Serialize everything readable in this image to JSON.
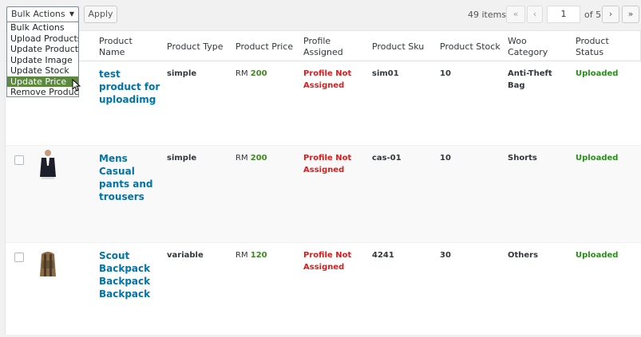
{
  "toolbar": {
    "bulk_select_value": "Bulk Actions",
    "apply_label": "Apply",
    "items_count": "49 items",
    "first_label": "«",
    "prev_label": "‹",
    "page_value": "1",
    "of_pages": "of 5",
    "next_label": "›",
    "last_label": "»"
  },
  "dropdown": {
    "options": [
      "Bulk Actions",
      "Upload Products",
      "Update Products",
      "Update Image",
      "Update Stock",
      "Update Price",
      "Remove Product"
    ],
    "selected": "Update Price"
  },
  "columns": {
    "name": "Product Name",
    "type": "Product Type",
    "price": "Product Price",
    "profile": "Profile Assigned",
    "sku": "Product Sku",
    "stock": "Product Stock",
    "category": "Woo Category",
    "status": "Product Status"
  },
  "rows": [
    {
      "name": "test product for uploadimg",
      "type": "simple",
      "currency": "RM",
      "price": "200",
      "profile": "Profile Not Assigned",
      "sku": "sim01",
      "stock": "10",
      "category": "Anti-Theft Bag",
      "status": "Uploaded"
    },
    {
      "name": "Mens Casual pants and trousers",
      "type": "simple",
      "currency": "RM",
      "price": "200",
      "profile": "Profile Not Assigned",
      "sku": "cas-01",
      "stock": "10",
      "category": "Shorts",
      "status": "Uploaded"
    },
    {
      "name": "Scout Backpack Backpack Backpack",
      "type": "variable",
      "currency": "RM",
      "price": "120",
      "profile": "Profile Not Assigned",
      "sku": "4241",
      "stock": "30",
      "category": "Others",
      "status": "Uploaded"
    }
  ],
  "colors": {
    "link": "#0073aa",
    "price": "#3c8a1f",
    "not_assigned": "#dc1d1d",
    "uploaded": "#2a8d1b",
    "dropdown_highlight": "#5b8a3e"
  }
}
